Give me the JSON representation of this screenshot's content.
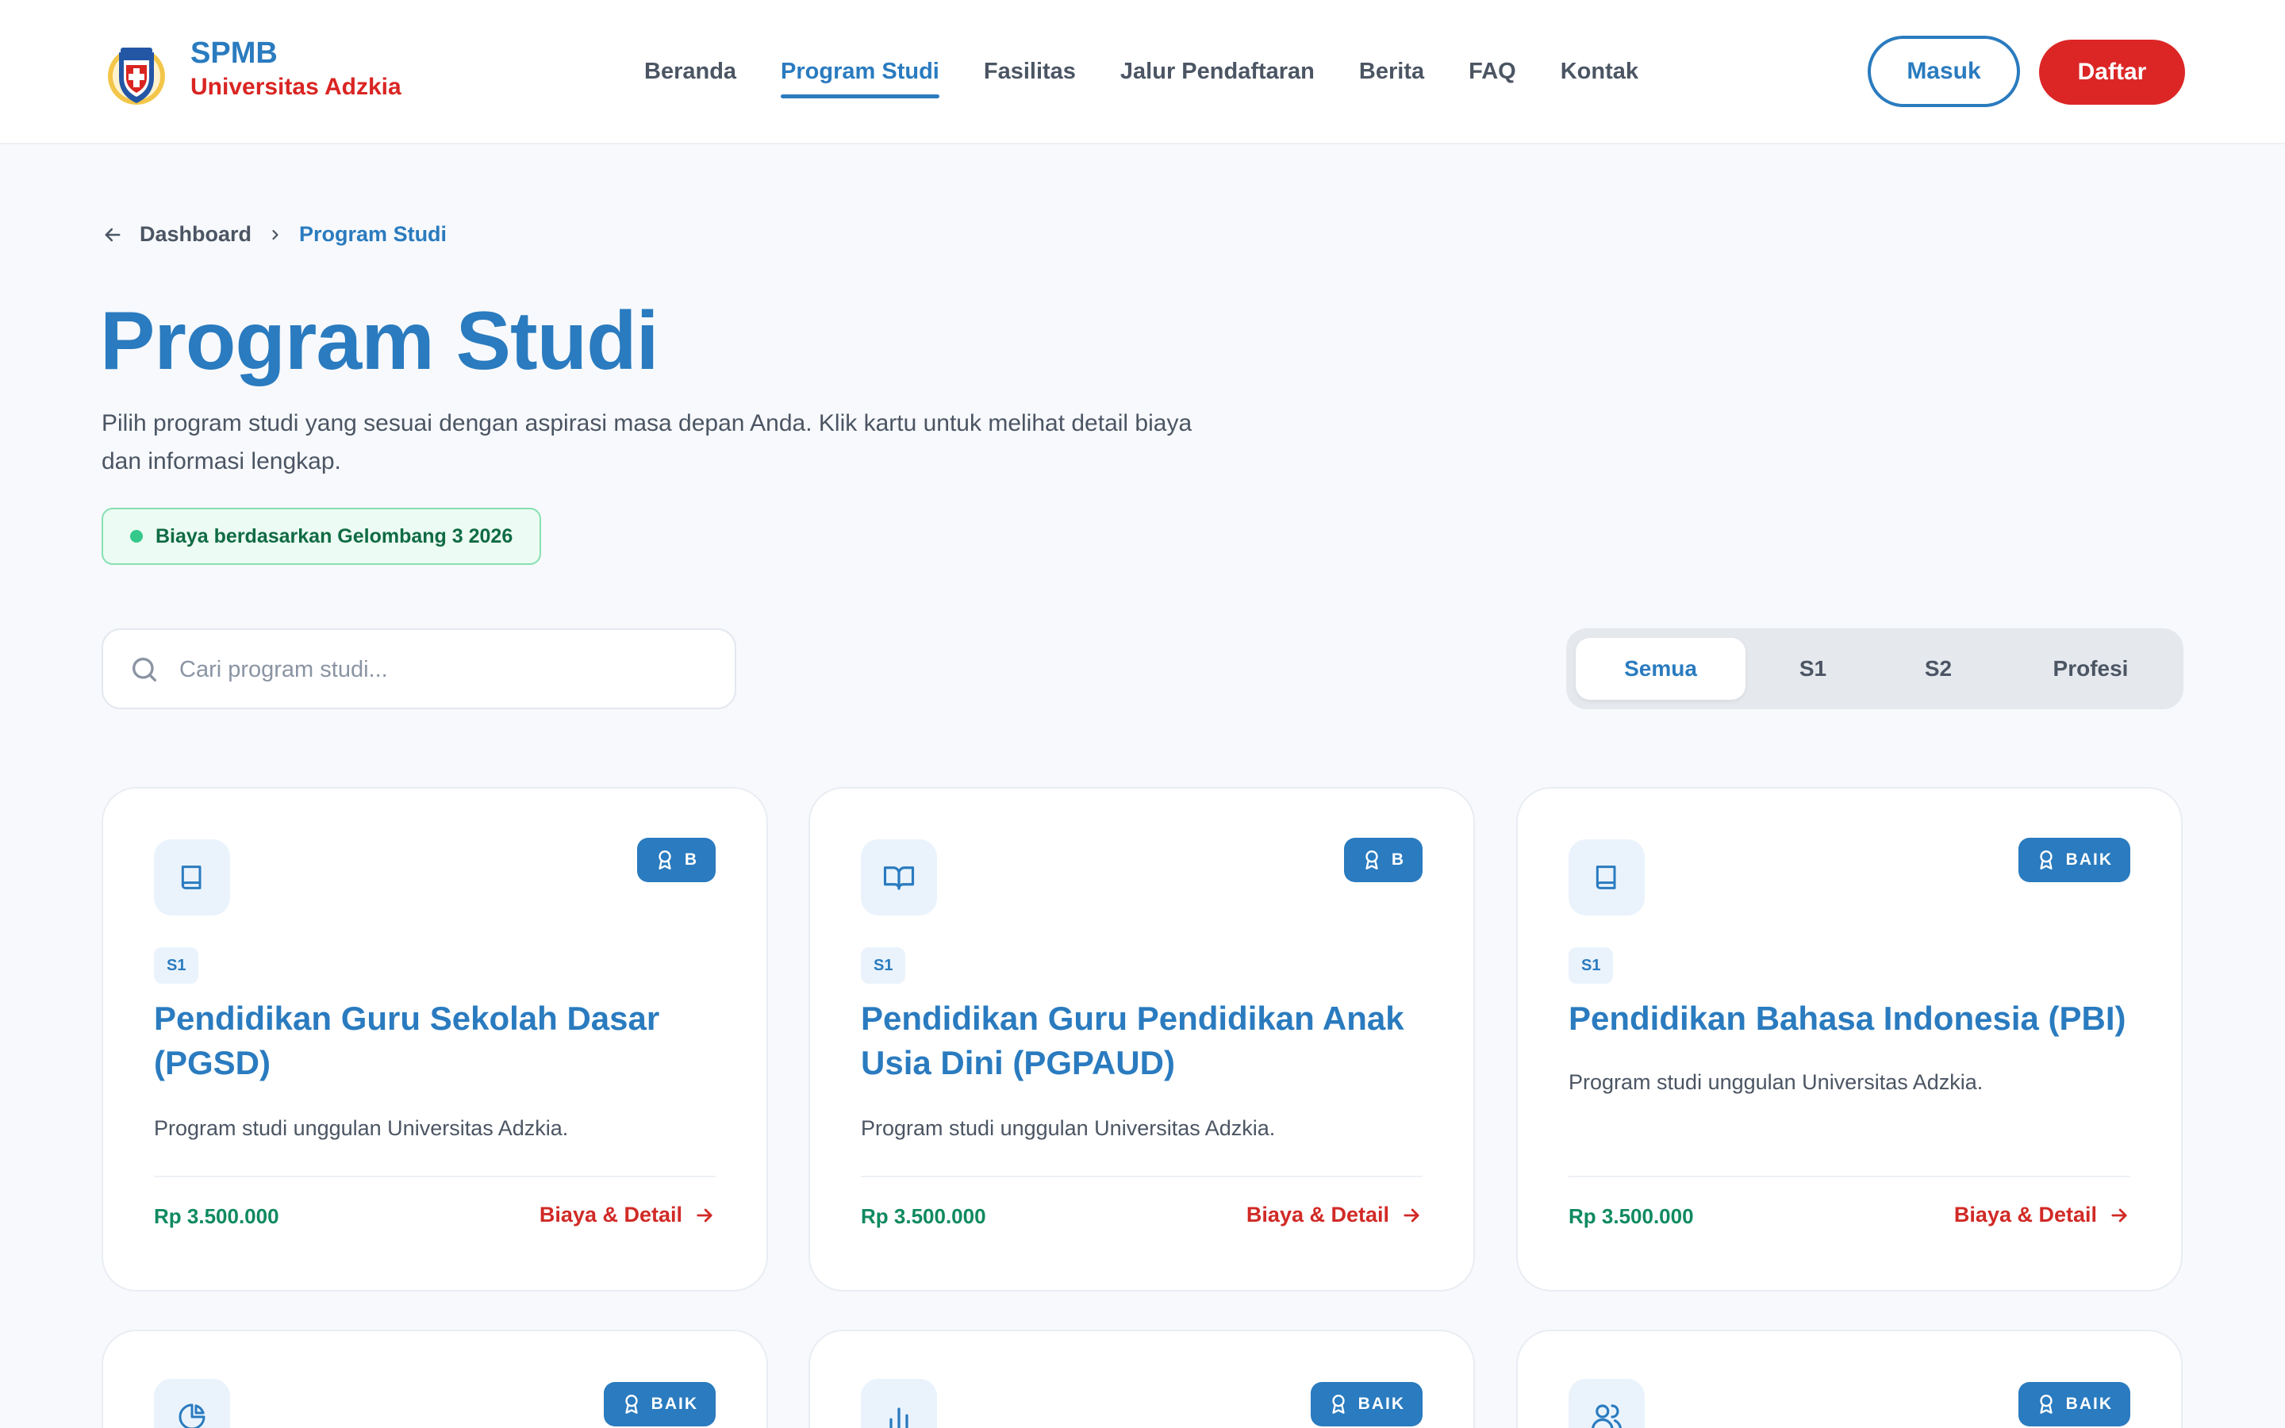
{
  "header": {
    "brand_top": "SPMB",
    "brand_bottom": "Universitas Adzkia",
    "nav": [
      "Beranda",
      "Program Studi",
      "Fasilitas",
      "Jalur Pendaftaran",
      "Berita",
      "FAQ",
      "Kontak"
    ],
    "active_nav": "Program Studi",
    "login_label": "Masuk",
    "register_label": "Daftar"
  },
  "breadcrumb": {
    "parent": "Dashboard",
    "current": "Program Studi"
  },
  "page": {
    "title": "Program Studi",
    "description": "Pilih program studi yang sesuai dengan aspirasi masa depan Anda. Klik kartu untuk melihat detail biaya dan informasi lengkap.",
    "fee_badge": "Biaya berdasarkan Gelombang 3 2026"
  },
  "search": {
    "placeholder": "Cari program studi..."
  },
  "filters": {
    "tabs": [
      "Semua",
      "S1",
      "S2",
      "Profesi"
    ],
    "active": "Semua"
  },
  "cards": [
    {
      "icon": "book-icon",
      "accreditation": "B",
      "level": "S1",
      "title": "Pendidikan Guru Sekolah Dasar (PGSD)",
      "description": "Program studi unggulan Universitas Adzkia.",
      "price": "Rp 3.500.000",
      "link": "Biaya & Detail"
    },
    {
      "icon": "open-book-icon",
      "accreditation": "B",
      "level": "S1",
      "title": "Pendidikan Guru Pendidikan Anak Usia Dini (PGPAUD)",
      "description": "Program studi unggulan Universitas Adzkia.",
      "price": "Rp 3.500.000",
      "link": "Biaya & Detail"
    },
    {
      "icon": "book-icon",
      "accreditation": "BAIK",
      "level": "S1",
      "title": "Pendidikan Bahasa Indonesia (PBI)",
      "description": "Program studi unggulan Universitas Adzkia.",
      "price": "Rp 3.500.000",
      "link": "Biaya & Detail"
    },
    {
      "icon": "pie-chart-icon",
      "accreditation": "BAIK"
    },
    {
      "icon": "bar-chart-icon",
      "accreditation": "BAIK"
    },
    {
      "icon": "users-icon",
      "accreditation": "BAIK"
    }
  ],
  "colors": {
    "primary": "#2a7bbf",
    "accent_red": "#dc2626",
    "success_green": "#0f8a5f",
    "background": "#f7f9fc"
  }
}
